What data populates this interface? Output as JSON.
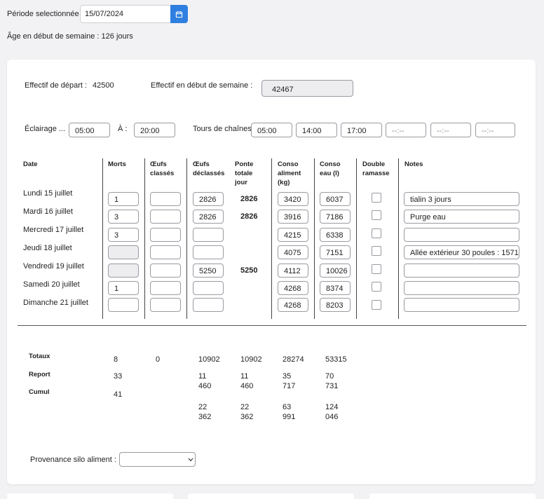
{
  "period": {
    "label": "Période selectionnée :",
    "value": "15/07/2024"
  },
  "age": "Âge en début de semaine : 126 jours",
  "effectif_depart": {
    "label": "Effectif de départ :",
    "value": "42500"
  },
  "effectif_semaine": {
    "label": "Effectif en début de semaine :",
    "value": "42467"
  },
  "eclairage": {
    "label": "Éclairage ...",
    "from": "05:00",
    "to_label": "À :",
    "to": "20:00"
  },
  "tours": {
    "label": "Tours de chaînes",
    "times": [
      "05:00",
      "14:00",
      "17:00",
      "--:--",
      "--:--",
      "--:--"
    ]
  },
  "headers": {
    "date": "Date",
    "morts": "Morts",
    "oeufs_classes": [
      "Œufs",
      "classés"
    ],
    "oeufs_declasses": [
      "Œufs",
      "déclassés"
    ],
    "ponte": [
      "Ponte",
      "totale",
      "jour"
    ],
    "aliment": [
      "Conso",
      "aliment",
      "(kg)"
    ],
    "eau": [
      "Conso",
      "eau (l)"
    ],
    "double": [
      "Double",
      "ramasse"
    ],
    "notes": "Notes"
  },
  "rows": [
    {
      "date": "Lundi 15 juillet",
      "morts": "1",
      "declasses": "2826",
      "ponte": "2826",
      "aliment": "3420",
      "eau": "6037",
      "notes": "tialin 3 jours"
    },
    {
      "date": "Mardi 16 juillet",
      "morts": "3",
      "declasses": "2826",
      "ponte": "2826",
      "aliment": "3916",
      "eau": "7186",
      "notes": "Purge eau"
    },
    {
      "date": "Mercredi 17 juillet",
      "morts": "3",
      "declasses": "",
      "ponte": "",
      "aliment": "4215",
      "eau": "6338",
      "notes": ""
    },
    {
      "date": "Jeudi 18 juillet",
      "morts": "",
      "declasses": "",
      "ponte": "",
      "aliment": "4075",
      "eau": "7151",
      "notes": "Allée extérieur 30 poules : 1571 gr"
    },
    {
      "date": "Vendredi 19 juillet",
      "morts": "",
      "declasses": "5250",
      "ponte": "5250",
      "aliment": "4112",
      "eau": "10026",
      "notes": ""
    },
    {
      "date": "Samedi 20 juillet",
      "morts": "1",
      "declasses": "",
      "ponte": "",
      "aliment": "4268",
      "eau": "8374",
      "notes": ""
    },
    {
      "date": "Dimanche 21 juillet",
      "morts": "",
      "declasses": "",
      "ponte": "",
      "aliment": "4268",
      "eau": "8203",
      "notes": ""
    }
  ],
  "totals": {
    "labels": [
      "Totaux",
      "Report",
      "Cumul"
    ],
    "morts": [
      "8",
      "33",
      "41"
    ],
    "classes": [
      "0"
    ],
    "declasses": [
      "10902",
      "11",
      "460",
      "22",
      "362"
    ],
    "ponte": [
      "10902",
      "11",
      "460",
      "22",
      "362"
    ],
    "aliment": [
      "28274",
      "35",
      "717",
      "63",
      "991"
    ],
    "eau": [
      "53315",
      "70",
      "731",
      "124",
      "046"
    ]
  },
  "provenance": {
    "label": "Provenance silo aliment :",
    "value": ""
  },
  "icons": {
    "calendar": "calendar-icon",
    "dropdown": "chevron-down-icon"
  },
  "colors": {
    "accent": "#2f7fe0",
    "background": "#f2f2f4"
  }
}
